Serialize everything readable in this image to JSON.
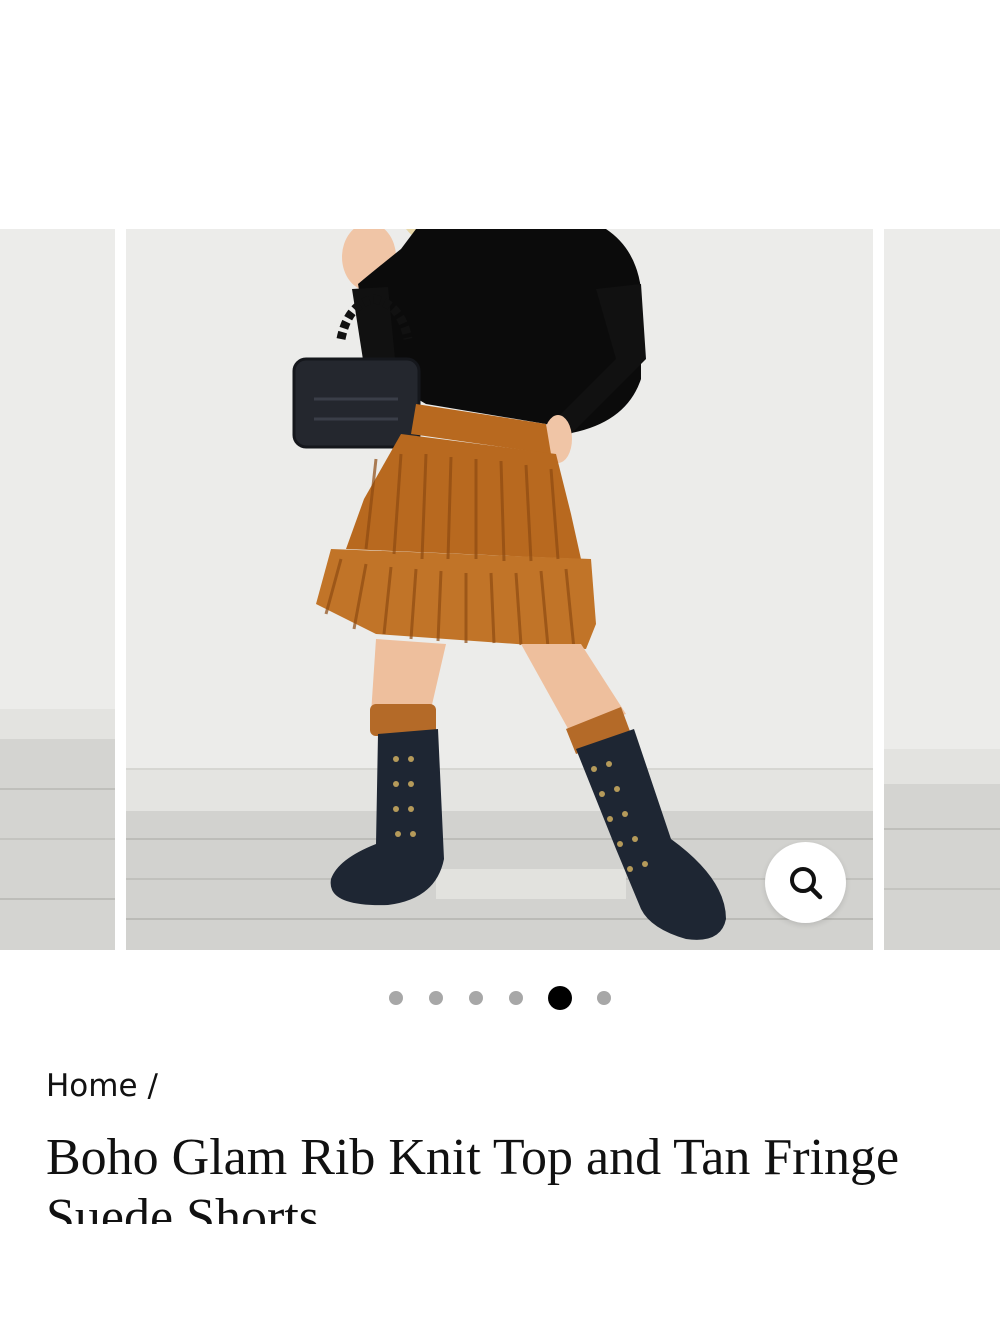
{
  "gallery": {
    "main_image_alt": "",
    "carousel": {
      "dot_count": 6,
      "active_index": 4
    }
  },
  "zoom": {
    "icon": "search-icon"
  },
  "breadcrumb": {
    "home_label": "Home",
    "separator": "/"
  },
  "product": {
    "title": "Boho Glam Rib Knit Top and Tan Fringe Suede Shorts"
  },
  "colors": {
    "dot_inactive": "#a7a7a7",
    "dot_active": "#000000",
    "fringe": "#b8691f"
  }
}
